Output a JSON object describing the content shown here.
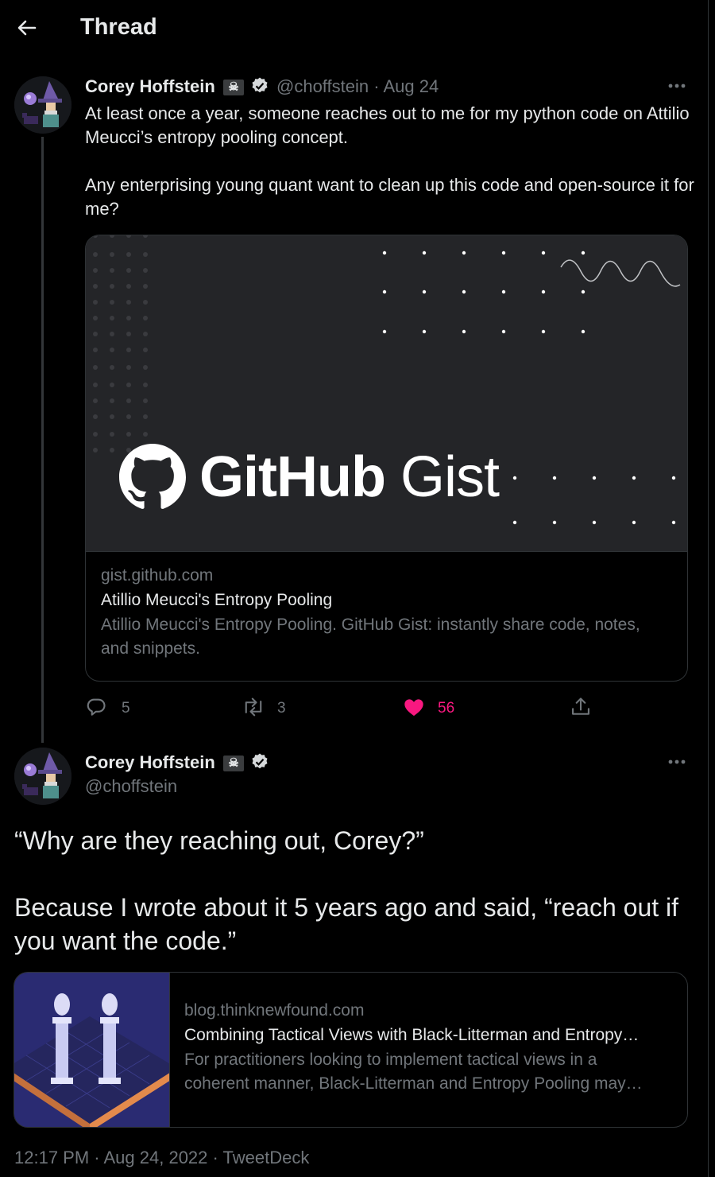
{
  "header": {
    "title": "Thread"
  },
  "tweet1": {
    "name": "Corey Hoffstein",
    "name_emoji": "☠",
    "handle": "@choffstein",
    "dot": "·",
    "date": "Aug 24",
    "text_p1": "At least once a year, someone reaches out to me for my python code on Attilio Meucci’s entropy pooling concept.",
    "text_p2": "Any enterprising young quant want to clean up this code and open-source it for me?",
    "card": {
      "image_text": "GitHub Gist",
      "image_text_bold": "GitHub",
      "image_text_light": "Gist",
      "domain": "gist.github.com",
      "title": "Atillio Meucci's Entropy Pooling",
      "description": "Atillio Meucci's Entropy Pooling. GitHub Gist: instantly share code, notes, and snippets."
    },
    "actions": {
      "replies": "5",
      "retweets": "3",
      "likes": "56"
    }
  },
  "tweet2": {
    "name": "Corey Hoffstein",
    "name_emoji": "☠",
    "handle": "@choffstein",
    "text_p1": "“Why are they reaching out, Corey?”",
    "text_p2": "Because I wrote about it 5 years ago and said, “reach out if you want the code.”",
    "card": {
      "domain": "blog.thinknewfound.com",
      "title": "Combining Tactical Views with Black-Litterman and Entropy…",
      "description_line1": "For practitioners looking to implement tactical views in a",
      "description_line2": "coherent manner, Black-Litterman and Entropy Pooling may…"
    },
    "meta": "12:17 PM · Aug 24, 2022 · TweetDeck"
  },
  "colors": {
    "background": "#000000",
    "text": "#e7e9ea",
    "secondary": "#71767b",
    "like": "#f91880",
    "border": "#2f3336"
  },
  "icons": [
    "back-arrow-icon",
    "verified-badge-icon",
    "more-icon",
    "reply-icon",
    "retweet-icon",
    "heart-icon",
    "share-icon",
    "github-logo-icon"
  ]
}
